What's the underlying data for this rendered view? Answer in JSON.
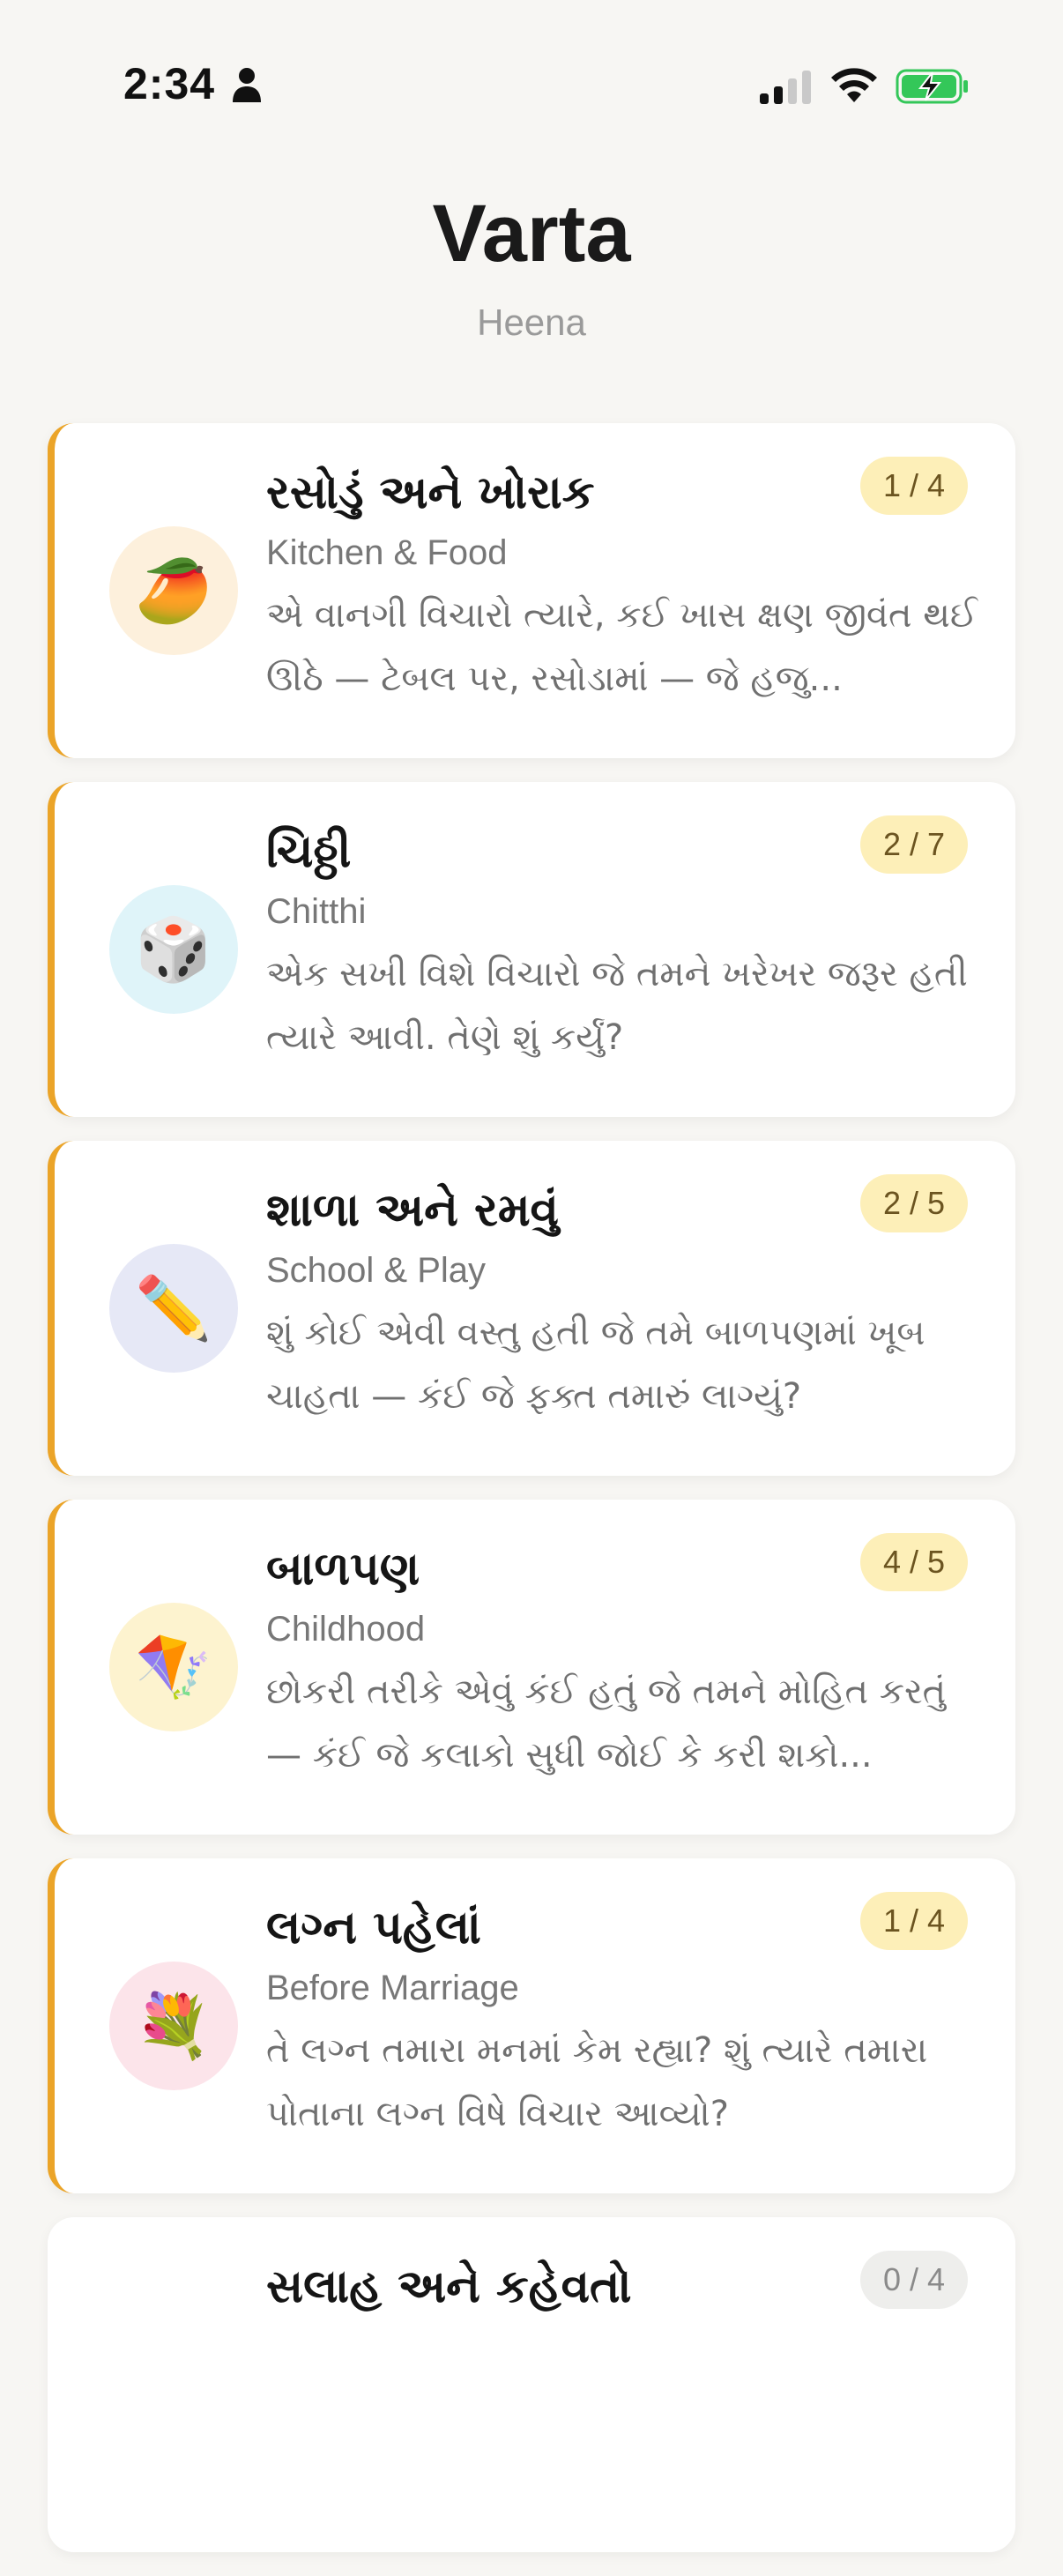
{
  "status_bar": {
    "time": "2:34",
    "icons": [
      "person-icon",
      "cellular-signal-icon",
      "wifi-icon",
      "battery-charging-icon"
    ],
    "battery_color": "#34c759"
  },
  "header": {
    "title": "Varta",
    "user": "Heena"
  },
  "colors": {
    "accent": "#eba428",
    "badge_bg": "#fdefb8",
    "background": "#f7f6f3"
  },
  "topics": [
    {
      "title": "રસોડું અને ખોરાક",
      "subtitle": "Kitchen & Food",
      "description": "એ વાનગી વિચારો ત્યારે, કઈ ખાસ ક્ષણ જીવંત થઈ ઊઠે — ટેબલ પર, રસોડામાં — જે હજુ...",
      "progress": "1 / 4",
      "icon": "mango-icon",
      "icon_glyph": "🥭",
      "icon_bg": "#fdf0dc"
    },
    {
      "title": "ચિઠ્ઠી",
      "subtitle": "Chitthi",
      "description": "એક સખી વિશે વિચારો જે તમને ખરેખર જરૂર હતી ત્યારે આવી. તેણે શું કર્યું?",
      "progress": "2 / 7",
      "icon": "dice-icon",
      "icon_glyph": "🎲",
      "icon_bg": "#dff4f9"
    },
    {
      "title": "શાળા અને રમવું",
      "subtitle": "School & Play",
      "description": "શું કોઈ એવી વસ્તુ હતી જે તમે બાળપણમાં ખૂબ ચાહતા — કંઈ જે ફક્ત તમારું લાગ્યું?",
      "progress": "2 / 5",
      "icon": "pencil-icon",
      "icon_glyph": "✏️",
      "icon_bg": "#e6e8f6"
    },
    {
      "title": "બાળપણ",
      "subtitle": "Childhood",
      "description": "છોકરી તરીકે એવું કંઈ હતું જે તમને મોહિત કરતું — કંઈ જે કલાકો સુધી જોઈ કે કરી શકો...",
      "progress": "4 / 5",
      "icon": "kite-icon",
      "icon_glyph": "🪁",
      "icon_bg": "#fdf3cf"
    },
    {
      "title": "લગ્ન પહેલાં",
      "subtitle": "Before Marriage",
      "description": "તે લગ્ન તમારા મનમાં કેમ રહ્યા? શું ત્યારે તમારા પોતાના લગ્ન વિષે વિચાર આવ્યો?",
      "progress": "1 / 4",
      "icon": "bouquet-icon",
      "icon_glyph": "💐",
      "icon_bg": "#fce4ea"
    },
    {
      "title": "સલાહ અને કહેવતો",
      "subtitle": "",
      "description": "",
      "progress": "0 / 4",
      "icon": "",
      "icon_glyph": "",
      "icon_bg": "#ffffff"
    }
  ]
}
